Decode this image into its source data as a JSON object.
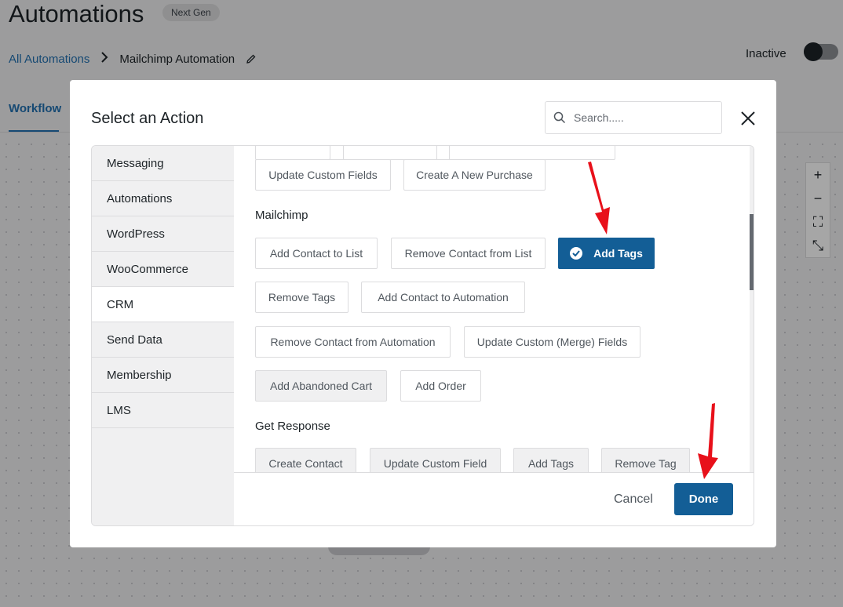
{
  "page": {
    "title": "Automations",
    "badge": "Next Gen",
    "breadcrumb": {
      "root": "All Automations",
      "current": "Mailchimp Automation"
    },
    "status_label": "Inactive",
    "status_active": false,
    "tab": "Workflow"
  },
  "zoom_controls": [
    "+",
    "−",
    "⛶",
    "⤡"
  ],
  "modal": {
    "title": "Select an Action",
    "search_placeholder": "Search.....",
    "categories": [
      {
        "label": "Messaging",
        "active": false
      },
      {
        "label": "Automations",
        "active": false
      },
      {
        "label": "WordPress",
        "active": false
      },
      {
        "label": "WooCommerce",
        "active": false
      },
      {
        "label": "CRM",
        "active": true
      },
      {
        "label": "Send Data",
        "active": false
      },
      {
        "label": "Membership",
        "active": false
      },
      {
        "label": "LMS",
        "active": false
      }
    ],
    "top_actions": [
      "Update Custom Fields",
      "Create A New Purchase"
    ],
    "mailchimp": {
      "label": "Mailchimp",
      "actions": [
        "Add Contact to List",
        "Remove Contact from List",
        "Add Tags",
        "Remove Tags",
        "Add Contact to Automation",
        "Remove Contact from Automation",
        "Update Custom (Merge) Fields",
        "Add Abandoned Cart",
        "Add Order"
      ],
      "selected": "Add Tags"
    },
    "get_response": {
      "label": "Get Response",
      "actions": [
        "Create Contact",
        "Update Custom Field",
        "Add Tags",
        "Remove Tag"
      ]
    },
    "footer": {
      "cancel": "Cancel",
      "done": "Done"
    }
  },
  "colors": {
    "primary": "#135e96",
    "link": "#2271b1",
    "arrow": "#e8101a"
  }
}
